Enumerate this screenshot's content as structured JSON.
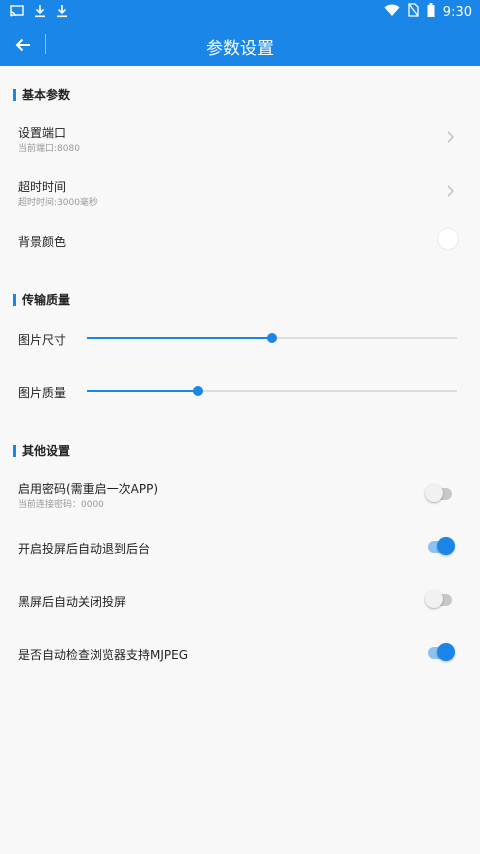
{
  "status_bar": {
    "time": "9:30",
    "left_icons": [
      "cast-icon",
      "download-icon",
      "download-icon"
    ],
    "right_icons": [
      "wifi-icon",
      "no-sim-icon",
      "battery-icon"
    ]
  },
  "app_bar": {
    "title": "参数设置",
    "back_icon": "arrow-left-icon"
  },
  "colors": {
    "accent": "#1a86e8",
    "background": "#f8f8f8"
  },
  "sections": {
    "basic": {
      "title": "基本参数",
      "port": {
        "title": "设置端口",
        "subtitle": "当前端口:8080"
      },
      "timeout": {
        "title": "超时时间",
        "subtitle": "超时时间:3000毫秒"
      },
      "bg_color": {
        "title": "背景颜色",
        "value": "#ffffff"
      }
    },
    "quality": {
      "title": "传输质量",
      "image_size": {
        "title": "图片尺寸",
        "value_fraction": 0.5
      },
      "image_quality": {
        "title": "图片质量",
        "value_fraction": 0.3
      }
    },
    "other": {
      "title": "其他设置",
      "password": {
        "title": "启用密码(需重启一次APP)",
        "subtitle": "当前连接密码：0000",
        "enabled": false
      },
      "auto_background": {
        "title": "开启投屏后自动退到后台",
        "enabled": true
      },
      "auto_close": {
        "title": "黑屏后自动关闭投屏",
        "enabled": false
      },
      "mjpeg_check": {
        "title": "是否自动检查浏览器支持MJPEG",
        "enabled": true
      }
    }
  }
}
